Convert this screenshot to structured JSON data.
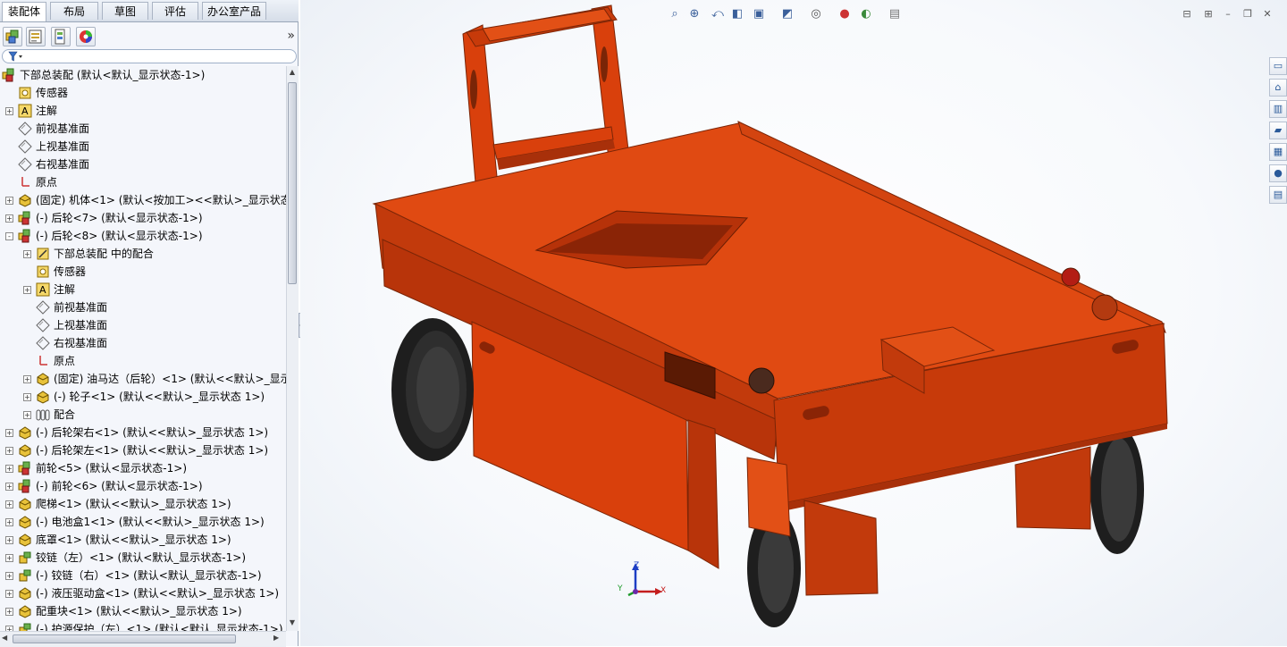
{
  "tabs": [
    "装配体",
    "布局",
    "草图",
    "评估",
    "办公室产品"
  ],
  "active_tab": 0,
  "panel_buttons": [
    "featuremanager-icon",
    "propertymanager-icon",
    "configurationmanager-icon",
    "appearance-icon"
  ],
  "panel_expand_label": "»",
  "filter_icon": "filter-icon",
  "tree": [
    {
      "depth": 0,
      "icon": "assembly",
      "exp": "",
      "label": "下部总装配  (默认<默认_显示状态-1>)"
    },
    {
      "depth": 1,
      "icon": "sensor",
      "exp": "",
      "label": "传感器"
    },
    {
      "depth": 1,
      "icon": "annotation",
      "exp": "+",
      "label": "注解"
    },
    {
      "depth": 1,
      "icon": "plane",
      "exp": "",
      "label": "前视基准面"
    },
    {
      "depth": 1,
      "icon": "plane",
      "exp": "",
      "label": "上视基准面"
    },
    {
      "depth": 1,
      "icon": "plane",
      "exp": "",
      "label": "右视基准面"
    },
    {
      "depth": 1,
      "icon": "origin",
      "exp": "",
      "label": "原点"
    },
    {
      "depth": 1,
      "icon": "part",
      "exp": "+",
      "label": "(固定) 机体<1> (默认<按加工><<默认>_显示状态"
    },
    {
      "depth": 1,
      "icon": "assembly",
      "exp": "+",
      "label": "(-) 后轮<7> (默认<显示状态-1>)"
    },
    {
      "depth": 1,
      "icon": "assembly",
      "exp": "-",
      "label": "(-) 后轮<8> (默认<显示状态-1>)"
    },
    {
      "depth": 2,
      "icon": "mate",
      "exp": "+",
      "label": "下部总装配 中的配合"
    },
    {
      "depth": 2,
      "icon": "sensor",
      "exp": "",
      "label": "传感器"
    },
    {
      "depth": 2,
      "icon": "annotation",
      "exp": "+",
      "label": "注解"
    },
    {
      "depth": 2,
      "icon": "plane",
      "exp": "",
      "label": "前视基准面"
    },
    {
      "depth": 2,
      "icon": "plane",
      "exp": "",
      "label": "上视基准面"
    },
    {
      "depth": 2,
      "icon": "plane",
      "exp": "",
      "label": "右视基准面"
    },
    {
      "depth": 2,
      "icon": "origin",
      "exp": "",
      "label": "原点"
    },
    {
      "depth": 2,
      "icon": "part",
      "exp": "+",
      "label": "(固定) 油马达（后轮）<1> (默认<<默认>_显示"
    },
    {
      "depth": 2,
      "icon": "part",
      "exp": "+",
      "label": "(-) 轮子<1> (默认<<默认>_显示状态 1>)"
    },
    {
      "depth": 2,
      "icon": "mates",
      "exp": "+",
      "label": "配合"
    },
    {
      "depth": 1,
      "icon": "part",
      "exp": "+",
      "label": "(-) 后轮架右<1> (默认<<默认>_显示状态 1>)"
    },
    {
      "depth": 1,
      "icon": "part",
      "exp": "+",
      "label": "(-) 后轮架左<1> (默认<<默认>_显示状态 1>)"
    },
    {
      "depth": 1,
      "icon": "assembly",
      "exp": "+",
      "label": "前轮<5> (默认<显示状态-1>)"
    },
    {
      "depth": 1,
      "icon": "assembly",
      "exp": "+",
      "label": "(-) 前轮<6> (默认<显示状态-1>)"
    },
    {
      "depth": 1,
      "icon": "part",
      "exp": "+",
      "label": "爬梯<1> (默认<<默认>_显示状态 1>)"
    },
    {
      "depth": 1,
      "icon": "part",
      "exp": "+",
      "label": "(-) 电池盒1<1> (默认<<默认>_显示状态 1>)"
    },
    {
      "depth": 1,
      "icon": "part",
      "exp": "+",
      "label": "底罩<1> (默认<<默认>_显示状态 1>)"
    },
    {
      "depth": 1,
      "icon": "subasm",
      "exp": "+",
      "label": "铰链（左）<1> (默认<默认_显示状态-1>)"
    },
    {
      "depth": 1,
      "icon": "subasm",
      "exp": "+",
      "label": "(-) 铰链（右）<1> (默认<默认_显示状态-1>)"
    },
    {
      "depth": 1,
      "icon": "part",
      "exp": "+",
      "label": "(-) 液压驱动盒<1> (默认<<默认>_显示状态 1>)"
    },
    {
      "depth": 1,
      "icon": "part",
      "exp": "+",
      "label": "配重块<1> (默认<<默认>_显示状态 1>)"
    },
    {
      "depth": 1,
      "icon": "subasm",
      "exp": "+",
      "label": "(-) 护源保护（左）<1> (默认<默认_显示状态-1>)"
    }
  ],
  "headsup_icons": [
    "zoom-to-fit-icon",
    "zoom-area-icon",
    "previous-view-icon",
    "section-view-icon",
    "view-orientation-icon",
    "display-style-icon",
    "hide-show-icon",
    "edit-appearance-icon",
    "apply-scene-icon",
    "view-settings-icon"
  ],
  "window_controls": [
    "tile-left-icon",
    "tile-right-icon",
    "minimize-icon",
    "restore-icon",
    "close-icon"
  ],
  "task_pane": [
    "resources-icon",
    "design-library-icon",
    "file-explorer-icon",
    "view-palette-icon",
    "appearances-icon",
    "custom-properties-icon",
    "sw-forum-icon"
  ],
  "triad": {
    "x": "X",
    "y": "Y",
    "z": "Z"
  },
  "colors": {
    "body": "#d9400c",
    "body_dark": "#a8300a",
    "body_light": "#ee5a1e",
    "tire": "#222222",
    "accent_blue": "#3a5f9a"
  }
}
